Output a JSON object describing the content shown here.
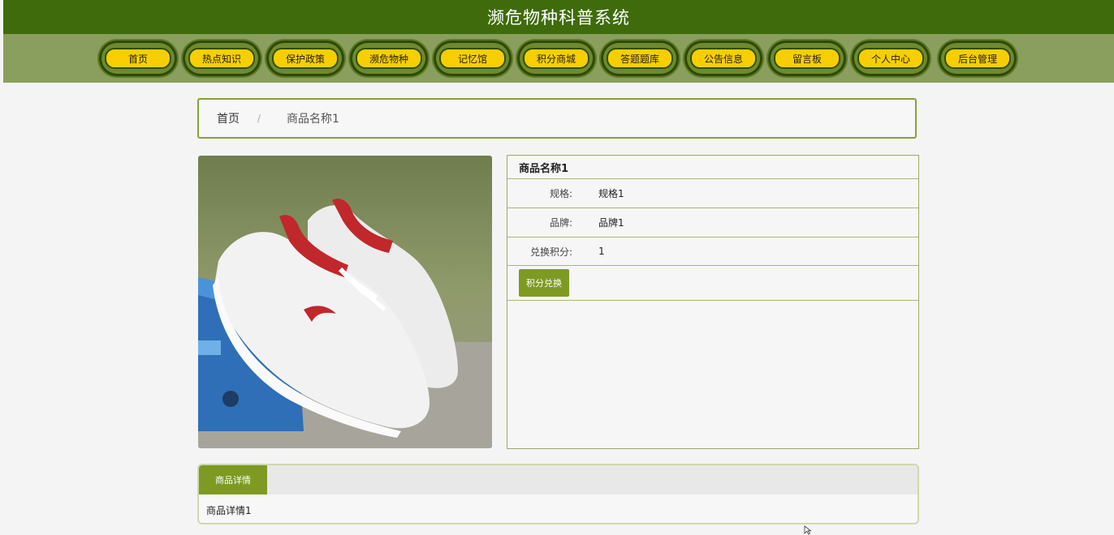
{
  "header": {
    "title": "濒危物种科普系统"
  },
  "nav": [
    {
      "label": "首页"
    },
    {
      "label": "热点知识"
    },
    {
      "label": "保护政策"
    },
    {
      "label": "濒危物种"
    },
    {
      "label": "记忆馆"
    },
    {
      "label": "积分商城"
    },
    {
      "label": "答题题库"
    },
    {
      "label": "公告信息"
    },
    {
      "label": "留言板"
    },
    {
      "label": "个人中心"
    },
    {
      "label": "后台管理"
    }
  ],
  "breadcrumb": {
    "home": "首页",
    "separator": "/",
    "current": "商品名称1"
  },
  "product": {
    "name": "商品名称1",
    "spec_label": "规格:",
    "spec_value": "规格1",
    "brand_label": "品牌:",
    "brand_value": "品牌1",
    "points_label": "兑换积分:",
    "points_value": "1",
    "redeem_label": "积分兑换"
  },
  "details": {
    "tab_label": "商品详情",
    "content": "商品详情1"
  },
  "colors": {
    "header_bg": "#3f6b0c",
    "nav_bg": "#8a9f5e",
    "pill": "#f7cf00",
    "accent": "#7e9a23"
  }
}
